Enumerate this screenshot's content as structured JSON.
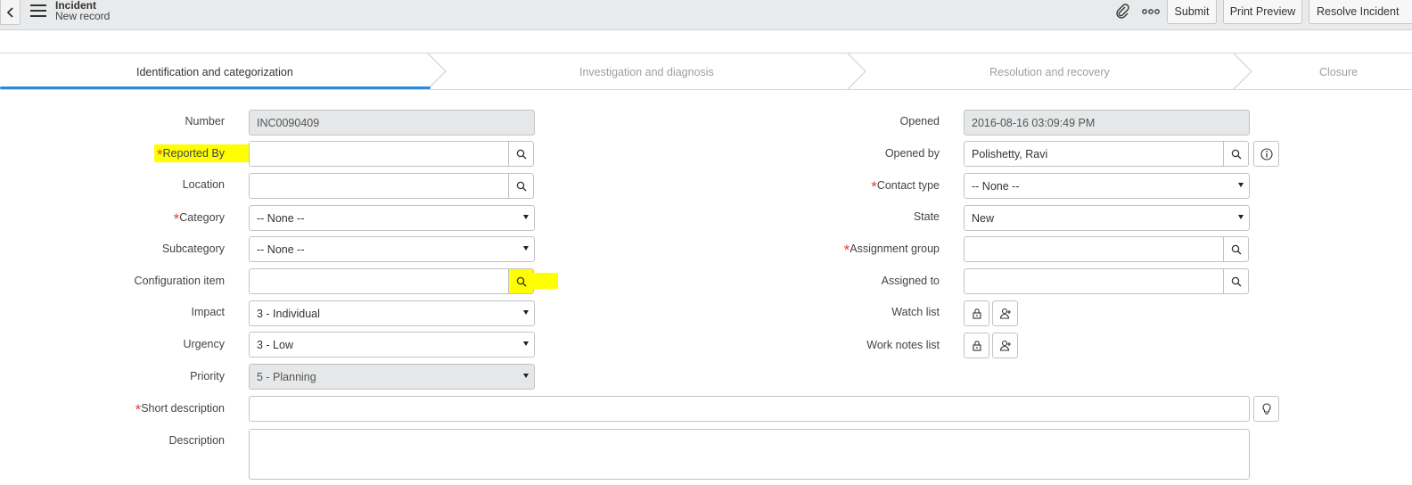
{
  "header": {
    "title": "Incident",
    "subtitle": "New record",
    "submit_label": "Submit",
    "print_preview_label": "Print Preview",
    "resolve_label": "Resolve Incident"
  },
  "stages": [
    {
      "label": "Identification and categorization",
      "active": true
    },
    {
      "label": "Investigation and diagnosis",
      "active": false
    },
    {
      "label": "Resolution and recovery",
      "active": false
    },
    {
      "label": "Closure",
      "active": false
    }
  ],
  "form_left": {
    "number": {
      "label": "Number",
      "value": "INC0090409"
    },
    "reported_by": {
      "label": "Reported By",
      "value": ""
    },
    "location": {
      "label": "Location",
      "value": ""
    },
    "category": {
      "label": "Category",
      "value": "-- None --"
    },
    "subcategory": {
      "label": "Subcategory",
      "value": "-- None --"
    },
    "configuration_item": {
      "label": "Configuration item",
      "value": ""
    },
    "impact": {
      "label": "Impact",
      "value": "3 - Individual"
    },
    "urgency": {
      "label": "Urgency",
      "value": "3 - Low"
    },
    "priority": {
      "label": "Priority",
      "value": "5 - Planning"
    },
    "short_description": {
      "label": "Short description",
      "value": ""
    },
    "description": {
      "label": "Description",
      "value": ""
    }
  },
  "form_right": {
    "opened": {
      "label": "Opened",
      "value": "2016-08-16 03:09:49 PM"
    },
    "opened_by": {
      "label": "Opened by",
      "value": "Polishetty, Ravi"
    },
    "contact_type": {
      "label": "Contact type",
      "value": "-- None --"
    },
    "state": {
      "label": "State",
      "value": "New"
    },
    "assignment_group": {
      "label": "Assignment group",
      "value": ""
    },
    "assigned_to": {
      "label": "Assigned to",
      "value": ""
    },
    "watch_list": {
      "label": "Watch list"
    },
    "work_notes_list": {
      "label": "Work notes list"
    }
  },
  "colors": {
    "accent": "#2e8ad8",
    "required": "#e23e3e",
    "highlight": "#ffff00"
  }
}
